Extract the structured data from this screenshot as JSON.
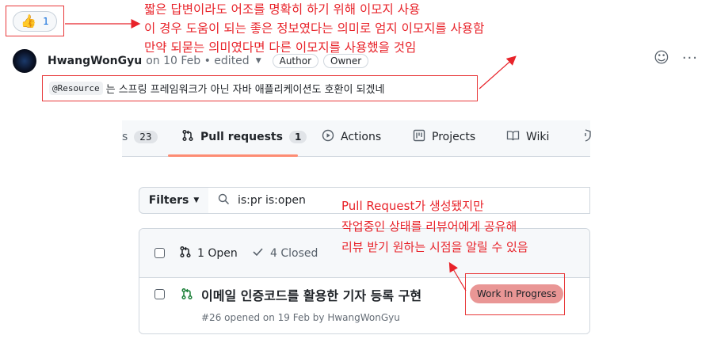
{
  "reaction": {
    "emoji": "👍",
    "count": "1",
    "icon": "thumbs-up-icon"
  },
  "comment": {
    "author": "HwangWonGyu",
    "meta": "on 10 Feb • edited",
    "badges": [
      "Author",
      "Owner"
    ],
    "code": "@Resource",
    "text": "는 스프링 프레임워크가 아닌 자바 애플리케이션도 호환이 되겠네"
  },
  "annotations": {
    "top": [
      "짧은 답변이라도 어조를 명확히 하기 위해 이모지 사용",
      "이 경우 도움이 되는 좋은 정보였다는 의미로 엄지 이모지를 사용함",
      "만약 되묻는 의미였다면 다른 이모지를 사용했을 것임"
    ],
    "right": [
      "Pull Request가 생성됐지만",
      "작업중인 상태를 리뷰어에게 공유해",
      "리뷰 받기 원하는 시점을 알릴 수 있음"
    ],
    "color": "#e8232a"
  },
  "repo": {
    "tabs": [
      {
        "label": "s",
        "counter": "23"
      },
      {
        "label": "Pull requests",
        "counter": "1"
      },
      {
        "label": "Actions"
      },
      {
        "label": "Projects"
      },
      {
        "label": "Wiki"
      }
    ],
    "filters_label": "Filters",
    "search_value": "is:pr is:open",
    "open_count": "1 Open",
    "closed_count": "4 Closed",
    "pr": {
      "title": "이메일 인증코드를 활용한 기자 등록 구현",
      "label": "Work In Progress",
      "label_color": "#e99695",
      "subtitle": "#26 opened on 19 Feb by HwangWonGyu"
    }
  }
}
